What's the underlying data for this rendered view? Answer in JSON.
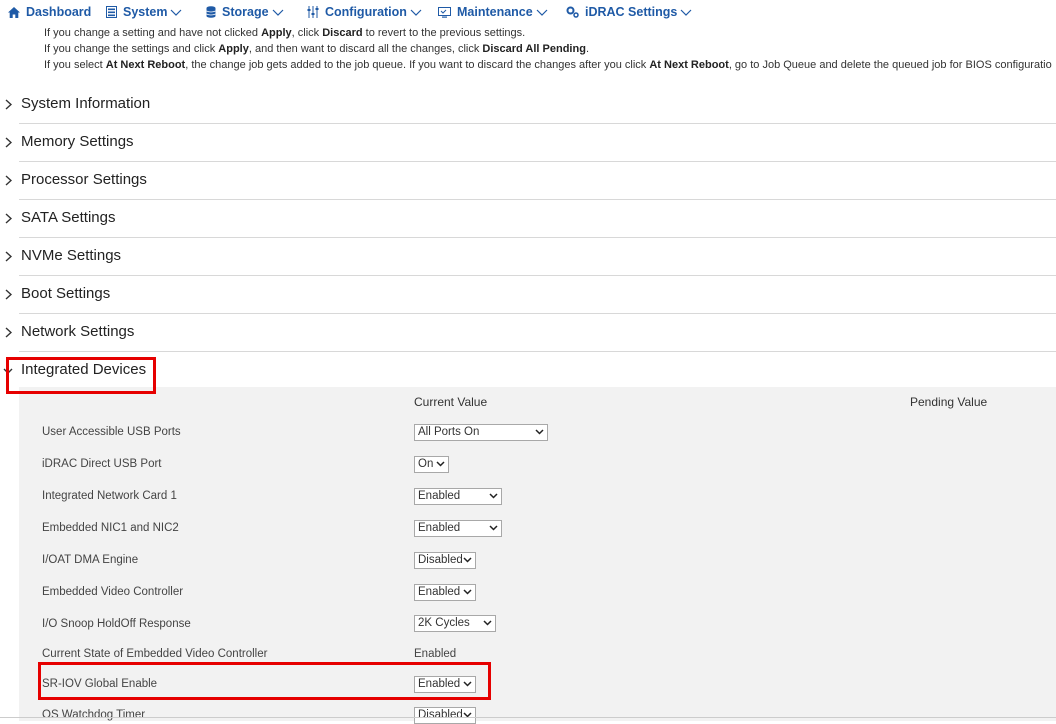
{
  "nav": {
    "dashboard": "Dashboard",
    "system": "System",
    "storage": "Storage",
    "configuration": "Configuration",
    "maintenance": "Maintenance",
    "idrac": "iDRAC Settings",
    "accent_color": "#1f5aa6",
    "icons": [
      "home-icon",
      "server-icon",
      "database-icon",
      "sliders-icon",
      "monitor-icon",
      "gears-icon"
    ]
  },
  "notes": [
    {
      "parts": [
        "If you change a setting and have not clicked ",
        "Apply",
        ", click ",
        "Discard",
        " to revert to the previous settings."
      ]
    },
    {
      "parts": [
        "If you change the settings and click ",
        "Apply",
        ", and then want to discard all the changes, click ",
        "Discard All Pending",
        "."
      ]
    },
    {
      "parts": [
        "If you select ",
        "At Next Reboot",
        ", the change job gets added to the job queue. If you want to discard the changes after you click ",
        "At Next Reboot",
        ", go to Job Queue and delete the queued job for BIOS configuratio"
      ]
    }
  ],
  "sections": [
    {
      "title": "System Information",
      "expanded": false
    },
    {
      "title": "Memory Settings",
      "expanded": false
    },
    {
      "title": "Processor Settings",
      "expanded": false
    },
    {
      "title": "SATA Settings",
      "expanded": false
    },
    {
      "title": "NVMe Settings",
      "expanded": false
    },
    {
      "title": "Boot Settings",
      "expanded": false
    },
    {
      "title": "Network Settings",
      "expanded": false
    },
    {
      "title": "Integrated Devices",
      "expanded": true
    }
  ],
  "table": {
    "current_header": "Current Value",
    "pending_header": "Pending Value",
    "rows": [
      {
        "label": "User Accessible USB Ports",
        "value": "All Ports On",
        "type": "select"
      },
      {
        "label": "iDRAC Direct USB Port",
        "value": "On",
        "type": "select"
      },
      {
        "label": "Integrated Network Card 1",
        "value": "Enabled",
        "type": "select"
      },
      {
        "label": "Embedded NIC1 and NIC2",
        "value": "Enabled",
        "type": "select"
      },
      {
        "label": "I/OAT DMA Engine",
        "value": "Disabled",
        "type": "select"
      },
      {
        "label": "Embedded Video Controller",
        "value": "Enabled",
        "type": "select"
      },
      {
        "label": "I/O Snoop HoldOff Response",
        "value": "2K Cycles",
        "type": "select"
      },
      {
        "label": "Current State of Embedded Video Controller",
        "value": "Enabled",
        "type": "text"
      },
      {
        "label": "SR-IOV Global Enable",
        "value": "Enabled",
        "type": "select"
      },
      {
        "label": "OS Watchdog Timer",
        "value": "Disabled",
        "type": "select"
      }
    ]
  },
  "highlight_color": "#e60000"
}
